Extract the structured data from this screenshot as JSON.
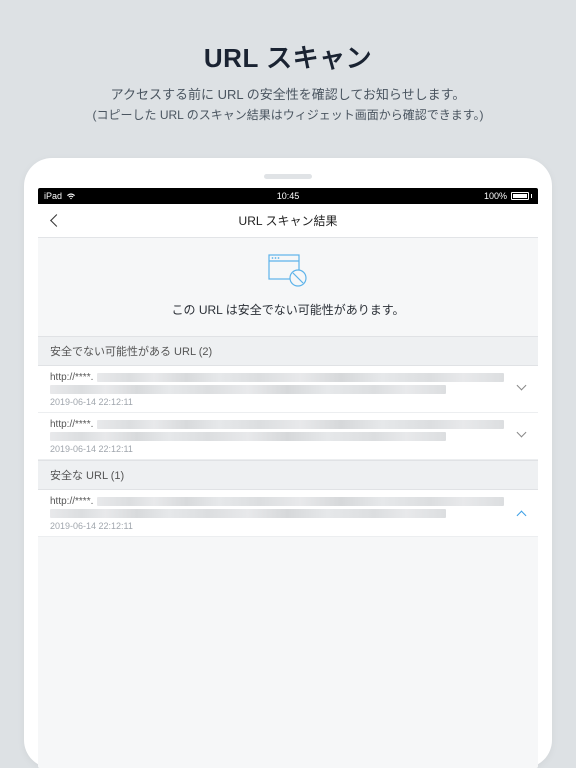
{
  "hero": {
    "title": "URL スキャン",
    "desc1": "アクセスする前に URL の安全性を確認してお知らせします。",
    "desc2": "(コピーした URL のスキャン結果はウィジェット画面から確認できます。)"
  },
  "statusbar": {
    "carrier": "iPad",
    "time": "10:45",
    "battery": "100%"
  },
  "navbar": {
    "title": "URL スキャン結果"
  },
  "banner": {
    "text": "この URL は安全でない可能性があります。"
  },
  "sections": {
    "unsafe": {
      "header": "安全でない可能性がある URL (2)",
      "items": [
        {
          "prefix": "http://****.",
          "timestamp": "2019-06-14 22:12:11",
          "expanded": false
        },
        {
          "prefix": "http://****.",
          "timestamp": "2019-06-14 22:12:11",
          "expanded": false
        }
      ]
    },
    "safe": {
      "header": "安全な URL (1)",
      "items": [
        {
          "prefix": "http://****.",
          "timestamp": "2019-06-14 22:12:11",
          "expanded": true
        }
      ]
    }
  }
}
